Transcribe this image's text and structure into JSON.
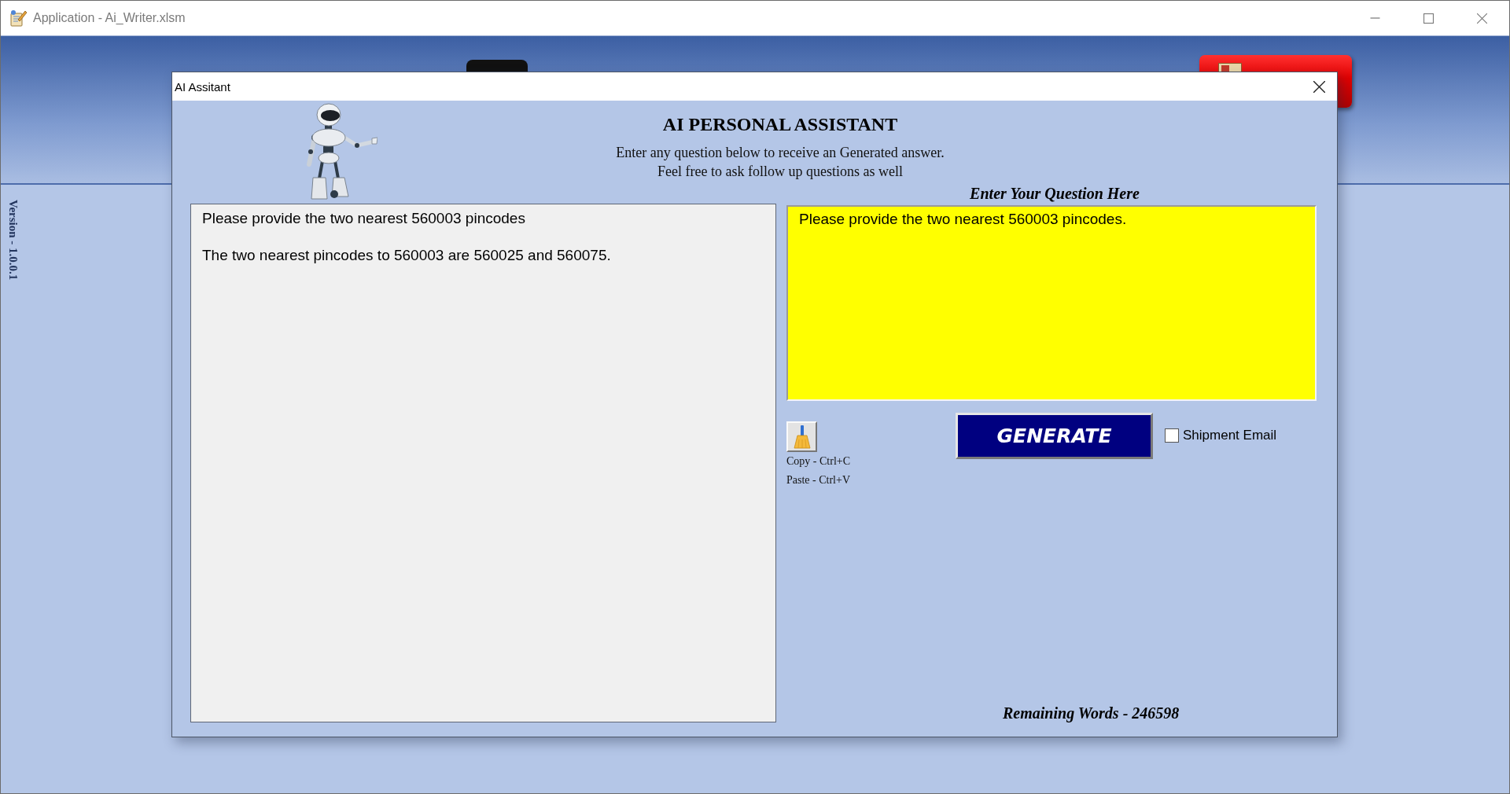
{
  "window": {
    "title": "Application - Ai_Writer.xlsm"
  },
  "sidebar": {
    "version": "Version - 1.0.0.1"
  },
  "dialog": {
    "title": "AI Assitant",
    "heading": "AI PERSONAL ASSISTANT",
    "subtitle_lines": [
      "Enter any question below to receive an Generated answer.",
      "Feel free to ask follow up questions as well"
    ],
    "conversation": [
      "Please provide the two nearest 560003 pincodes",
      "The two nearest pincodes to 560003 are 560025 and 560075."
    ],
    "question_label": "Enter Your Question Here",
    "question": {
      "value": "Please provide the two nearest 560003 pincodes."
    },
    "shortcuts": [
      "Copy - Ctrl+C",
      "Paste - Ctrl+V"
    ],
    "generate_button": "GENERATE",
    "checkbox": {
      "label": "Shipment Email",
      "checked": false
    },
    "remaining_words": "Remaining Words - 246598"
  }
}
